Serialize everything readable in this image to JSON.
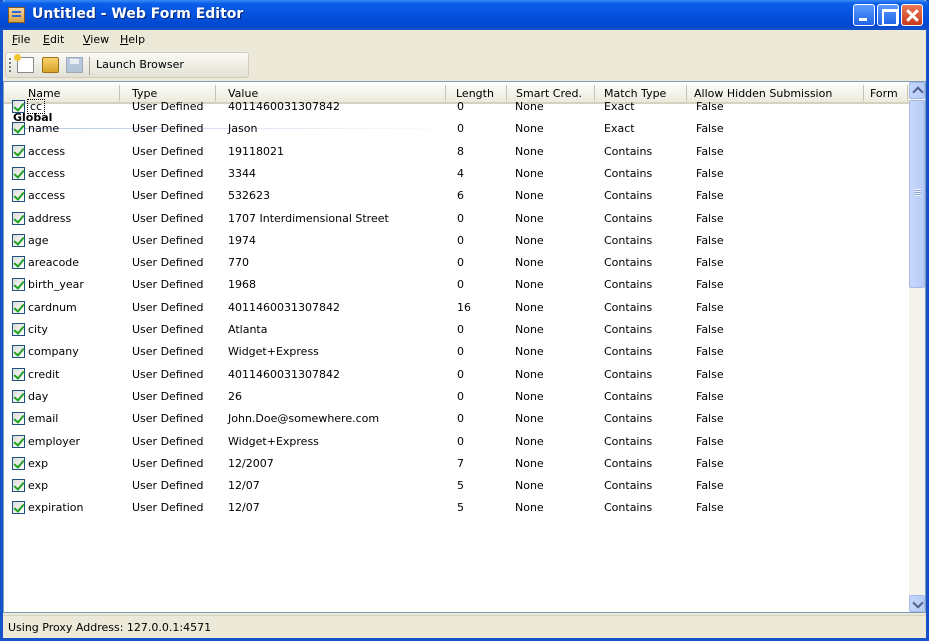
{
  "window": {
    "title": "Untitled - Web Form Editor"
  },
  "menu": [
    {
      "label": "File",
      "u": "F",
      "rest": "ile"
    },
    {
      "label": "Edit",
      "u": "E",
      "rest": "dit"
    },
    {
      "label": "View",
      "u": "V",
      "rest": "iew"
    },
    {
      "label": "Help",
      "u": "H",
      "rest": "elp"
    }
  ],
  "toolbar": {
    "icons": [
      "new-file-icon",
      "open-folder-icon",
      "save-disk-icon"
    ],
    "launch_label": "Launch Browser"
  },
  "table": {
    "columns": [
      "Name",
      "Type",
      "Value",
      "Length",
      "Smart Cred.",
      "Match Type",
      "Allow Hidden Submission",
      "Form"
    ],
    "group": "Global",
    "rows": [
      {
        "checked": true,
        "name": "cc",
        "type": "User Defined",
        "value": "4011460031307842",
        "length": "0",
        "smart": "None",
        "match": "Exact",
        "hidden": "False"
      },
      {
        "checked": true,
        "name": "name",
        "type": "User Defined",
        "value": "Jason",
        "length": "0",
        "smart": "None",
        "match": "Exact",
        "hidden": "False"
      },
      {
        "checked": true,
        "name": "access",
        "type": "User Defined",
        "value": "19118021",
        "length": "8",
        "smart": "None",
        "match": "Contains",
        "hidden": "False"
      },
      {
        "checked": true,
        "name": "access",
        "type": "User Defined",
        "value": "3344",
        "length": "4",
        "smart": "None",
        "match": "Contains",
        "hidden": "False"
      },
      {
        "checked": true,
        "name": "access",
        "type": "User Defined",
        "value": "532623",
        "length": "6",
        "smart": "None",
        "match": "Contains",
        "hidden": "False"
      },
      {
        "checked": true,
        "name": "address",
        "type": "User Defined",
        "value": "1707 Interdimensional Street",
        "length": "0",
        "smart": "None",
        "match": "Contains",
        "hidden": "False"
      },
      {
        "checked": true,
        "name": "age",
        "type": "User Defined",
        "value": "1974",
        "length": "0",
        "smart": "None",
        "match": "Contains",
        "hidden": "False"
      },
      {
        "checked": true,
        "name": "areacode",
        "type": "User Defined",
        "value": "770",
        "length": "0",
        "smart": "None",
        "match": "Contains",
        "hidden": "False"
      },
      {
        "checked": true,
        "name": "birth_year",
        "type": "User Defined",
        "value": "1968",
        "length": "0",
        "smart": "None",
        "match": "Contains",
        "hidden": "False"
      },
      {
        "checked": true,
        "name": "cardnum",
        "type": "User Defined",
        "value": "4011460031307842",
        "length": "16",
        "smart": "None",
        "match": "Contains",
        "hidden": "False"
      },
      {
        "checked": true,
        "name": "city",
        "type": "User Defined",
        "value": "Atlanta",
        "length": "0",
        "smart": "None",
        "match": "Contains",
        "hidden": "False"
      },
      {
        "checked": true,
        "name": "company",
        "type": "User Defined",
        "value": "Widget+Express",
        "length": "0",
        "smart": "None",
        "match": "Contains",
        "hidden": "False"
      },
      {
        "checked": true,
        "name": "credit",
        "type": "User Defined",
        "value": "4011460031307842",
        "length": "0",
        "smart": "None",
        "match": "Contains",
        "hidden": "False"
      },
      {
        "checked": true,
        "name": "day",
        "type": "User Defined",
        "value": "26",
        "length": "0",
        "smart": "None",
        "match": "Contains",
        "hidden": "False"
      },
      {
        "checked": true,
        "name": "email",
        "type": "User Defined",
        "value": "John.Doe@somewhere.com",
        "length": "0",
        "smart": "None",
        "match": "Contains",
        "hidden": "False"
      },
      {
        "checked": true,
        "name": "employer",
        "type": "User Defined",
        "value": "Widget+Express",
        "length": "0",
        "smart": "None",
        "match": "Contains",
        "hidden": "False"
      },
      {
        "checked": true,
        "name": "exp",
        "type": "User Defined",
        "value": "12/2007",
        "length": "7",
        "smart": "None",
        "match": "Contains",
        "hidden": "False"
      },
      {
        "checked": true,
        "name": "exp",
        "type": "User Defined",
        "value": "12/07",
        "length": "5",
        "smart": "None",
        "match": "Contains",
        "hidden": "False"
      },
      {
        "checked": true,
        "name": "expiration",
        "type": "User Defined",
        "value": "12/07",
        "length": "5",
        "smart": "None",
        "match": "Contains",
        "hidden": "False"
      }
    ]
  },
  "status": {
    "text": "Using Proxy Address: 127.0.0.1:4571"
  }
}
